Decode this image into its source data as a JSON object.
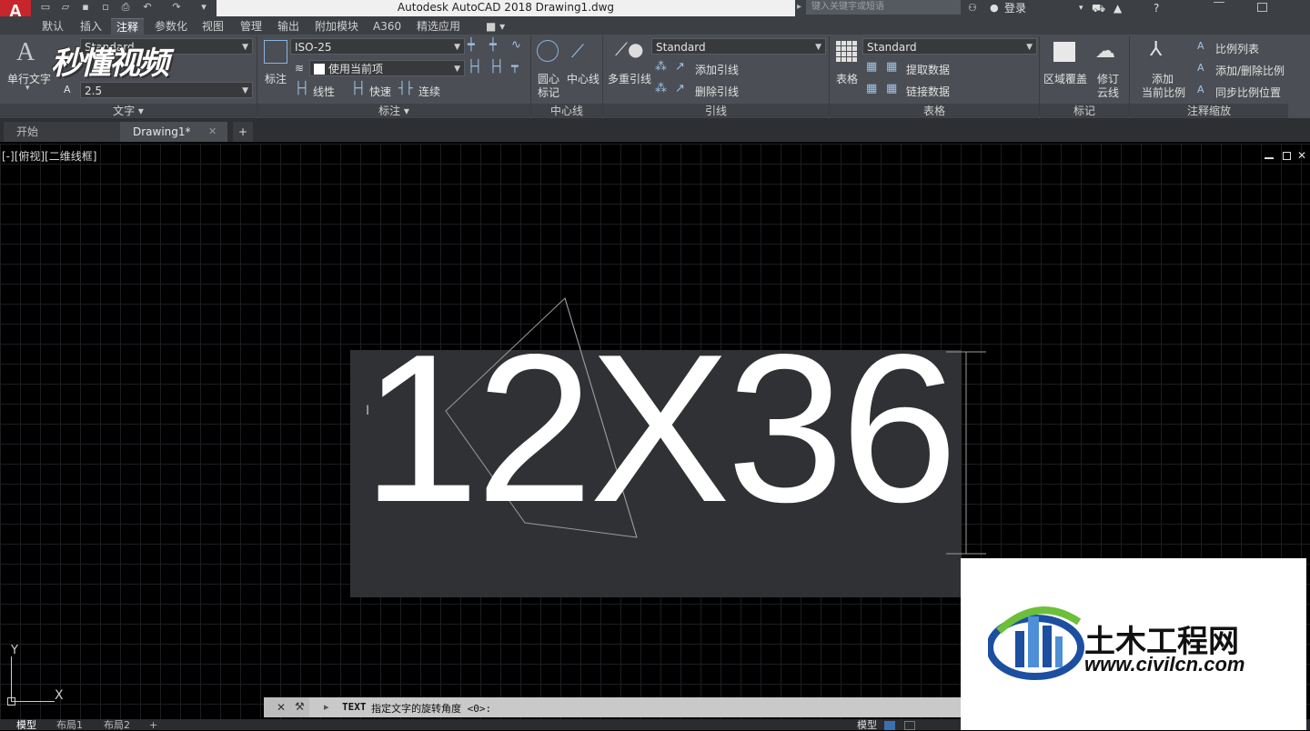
{
  "app": {
    "logo_letter": "A",
    "window_title": "Autodesk AutoCAD 2018    Drawing1.dwg",
    "search_placeholder": "键入关键字或短语",
    "login_label": "登录"
  },
  "menu_tabs": [
    "默认",
    "插入",
    "注释",
    "参数化",
    "视图",
    "管理",
    "输出",
    "附加模块",
    "A360",
    "精选应用"
  ],
  "active_tab": "注释",
  "ribbon": {
    "text_panel": {
      "title": "文字",
      "single_line_text": "单行文字",
      "style_value": "Standard",
      "height_value": "2.5",
      "watermark_overlay": "秒懂视频"
    },
    "dim_panel": {
      "title": "标注",
      "dimension_label": "标注",
      "style_value": "ISO-25",
      "layer_value": "使用当前项",
      "linear_label": "线性",
      "quick_label": "快速",
      "continue_label": "连续"
    },
    "centerline_panel": {
      "title": "中心线",
      "center_mark_label_1": "圆心",
      "center_mark_label_2": "标记",
      "centerline_label": "中心线"
    },
    "leader_panel": {
      "title": "引线",
      "multileader_label": "多重引线",
      "style_value": "Standard",
      "add_leader_label": "添加引线",
      "remove_leader_label": "删除引线"
    },
    "table_panel": {
      "title": "表格",
      "table_label": "表格",
      "style_value": "Standard",
      "extract_data_label": "提取数据",
      "link_data_label": "链接数据"
    },
    "markup_panel": {
      "title": "标记",
      "wipeout_label": "区域覆盖",
      "revcloud_label_1": "修订",
      "revcloud_label_2": "云线"
    },
    "scale_panel": {
      "title": "注释缩放",
      "add_current_label_1": "添加",
      "add_current_label_2": "当前比例",
      "scale_list_label": "比例列表",
      "add_delete_label": "添加/删除比例",
      "sync_label": "同步比例位置"
    }
  },
  "doc_tabs": {
    "start": "开始",
    "drawing": "Drawing1*",
    "add": "+"
  },
  "viewport": {
    "label": "[-][俯视][二维线框]",
    "text_content": "12X36",
    "ucs_y": "Y",
    "ucs_x": "X"
  },
  "command": {
    "prompt_cmd": "TEXT",
    "prompt_text": "指定文字的旋转角度 <0>:"
  },
  "layout_tabs": [
    "模型",
    "布局1",
    "布局2"
  ],
  "status": {
    "model_label": "模型"
  },
  "watermark": {
    "site_name": "土木工程网",
    "site_url": "www.civilcn.com"
  },
  "colors": {
    "accent_red": "#c8252c",
    "ribbon_bg": "#4b4e54",
    "canvas_bg": "#000000",
    "watermark_blue": "#1c4fa0",
    "watermark_green": "#6cbf3a"
  }
}
